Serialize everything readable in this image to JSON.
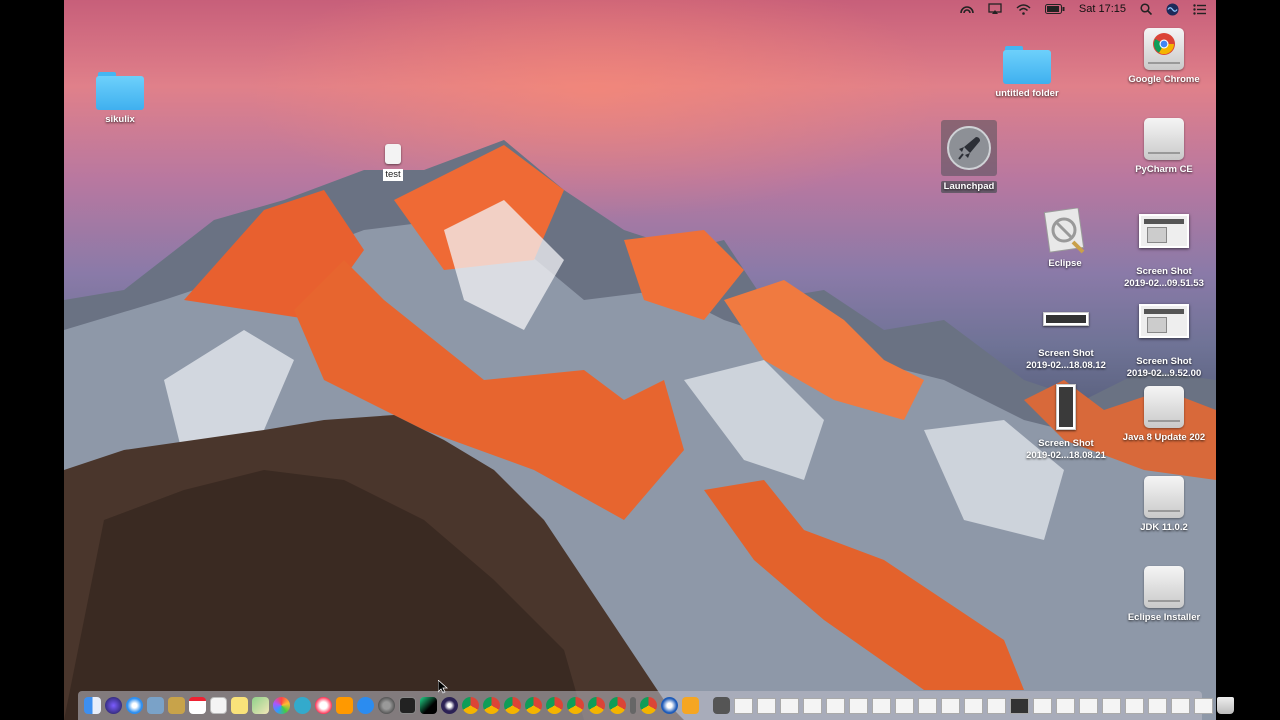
{
  "menubar": {
    "icons": [
      "creative-cloud-icon",
      "airplay-icon",
      "wifi-icon",
      "battery-icon"
    ],
    "clock": "Sat 17:15",
    "right_icons": [
      "spotlight-icon",
      "siri-icon",
      "notification-center-icon"
    ]
  },
  "desktop": {
    "left_items": [
      {
        "label": "sikulix",
        "kind": "folder"
      },
      {
        "label": "test",
        "kind": "file"
      }
    ],
    "launchpad": {
      "label": "Launchpad",
      "selected": true
    },
    "right_items": [
      {
        "label": "untitled folder",
        "kind": "folder"
      },
      {
        "label": "Google Chrome",
        "kind": "disk"
      },
      {
        "label": "PyCharm CE",
        "kind": "disk"
      },
      {
        "label": "Eclipse",
        "kind": "app"
      },
      {
        "line1": "Screen Shot",
        "line2": "2019-02...09.51.53",
        "kind": "screenshot"
      },
      {
        "line1": "Screen Shot",
        "line2": "2019-02...18.08.12",
        "kind": "screenshot"
      },
      {
        "line1": "Screen Shot",
        "line2": "2019-02...9.52.00",
        "kind": "screenshot"
      },
      {
        "line1": "Screen Shot",
        "line2": "2019-02...18.08.21",
        "kind": "screenshot"
      },
      {
        "label": "Java 8 Update 202",
        "kind": "disk"
      },
      {
        "label": "JDK 11.0.2",
        "kind": "disk"
      },
      {
        "label": "Eclipse Installer",
        "kind": "disk"
      }
    ]
  },
  "dock": {
    "apps": [
      "finder-icon",
      "siri-icon",
      "safari-icon",
      "preview-icon",
      "notes-icon",
      "calendar-icon",
      "textedit-icon",
      "stickies-icon",
      "maps-icon",
      "photos-icon",
      "messages-icon",
      "itunes-icon",
      "ibooks-icon",
      "app-store-icon",
      "system-preferences-icon",
      "terminal-icon",
      "pycharm-icon",
      "eclipse-icon",
      "chrome-icon",
      "chrome-icon",
      "chrome-icon",
      "chrome-icon",
      "chrome-icon",
      "chrome-icon",
      "chrome-icon",
      "chrome-icon",
      "eclipse-launcher-icon",
      "chrome-icon",
      "xquartz-icon",
      "sikulix-icon"
    ],
    "minimized_windows": 21,
    "trash": "trash-icon"
  }
}
